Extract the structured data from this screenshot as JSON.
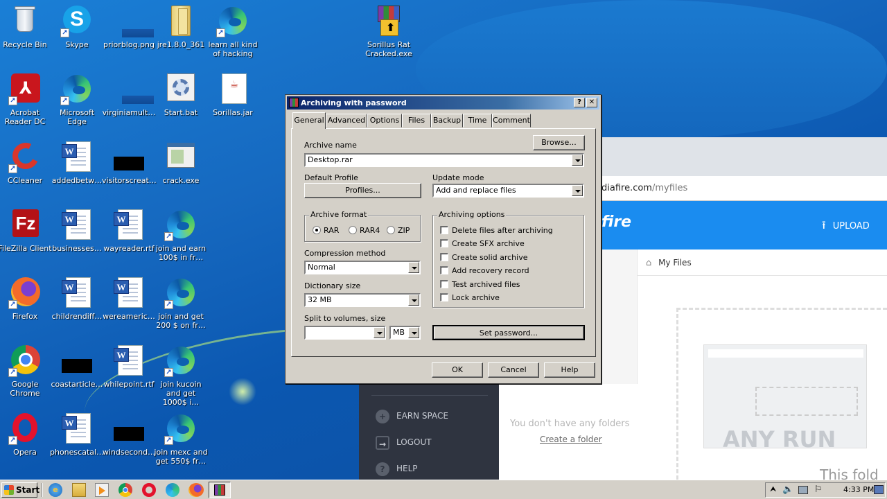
{
  "desktop": {
    "icons": [
      {
        "label": "Recycle Bin",
        "icon": "recycle-bin-icon"
      },
      {
        "label": "Skype",
        "icon": "skype-icon"
      },
      {
        "label": "priorblog.png",
        "icon": "image-file-icon"
      },
      {
        "label": "jre1.8.0_361",
        "icon": "folder-icon"
      },
      {
        "label": "learn all kind of hacking",
        "icon": "edge-shortcut-icon"
      },
      {
        "label": "Sorillus Rat Cracked.exe",
        "icon": "winrar-exe-icon"
      },
      {
        "label": "Acrobat Reader DC",
        "icon": "acrobat-icon"
      },
      {
        "label": "Microsoft Edge",
        "icon": "edge-icon"
      },
      {
        "label": "virginiamult…",
        "icon": "image-file-icon"
      },
      {
        "label": "Start.bat",
        "icon": "batch-file-icon"
      },
      {
        "label": "Sorillas.jar",
        "icon": "java-file-icon"
      },
      {
        "label": "CCleaner",
        "icon": "ccleaner-icon"
      },
      {
        "label": "addedbetw…",
        "icon": "word-doc-icon"
      },
      {
        "label": "visitorscreat…",
        "icon": "image-file-icon"
      },
      {
        "label": "crack.exe",
        "icon": "exe-file-icon"
      },
      {
        "label": "FileZilla Client",
        "icon": "filezilla-icon"
      },
      {
        "label": "businesses…",
        "icon": "word-doc-icon"
      },
      {
        "label": "wayreader.rtf",
        "icon": "word-doc-icon"
      },
      {
        "label": "join and earn 100$ in fr…",
        "icon": "edge-shortcut-icon"
      },
      {
        "label": "Firefox",
        "icon": "firefox-icon"
      },
      {
        "label": "childrendiff…",
        "icon": "word-doc-icon"
      },
      {
        "label": "wereameric…",
        "icon": "word-doc-icon"
      },
      {
        "label": "join and get 200 $ on fr…",
        "icon": "edge-shortcut-icon"
      },
      {
        "label": "Google Chrome",
        "icon": "chrome-icon"
      },
      {
        "label": "coastarticle…",
        "icon": "image-file-icon"
      },
      {
        "label": "whilepoint.rtf",
        "icon": "word-doc-icon"
      },
      {
        "label": "join kucoin and get 1000$ i…",
        "icon": "edge-shortcut-icon"
      },
      {
        "label": "Opera",
        "icon": "opera-icon"
      },
      {
        "label": "phonescatal…",
        "icon": "word-doc-icon"
      },
      {
        "label": "windsecond…",
        "icon": "image-file-icon"
      },
      {
        "label": "join mexc and get 550$ fr…",
        "icon": "edge-shortcut-icon"
      }
    ]
  },
  "browser": {
    "address": "diafire.com",
    "address_path": "/myfiles",
    "brand": "fire",
    "upload_label": "UPLOAD",
    "breadcrumb": "My Files",
    "menu": [
      "EARN SPACE",
      "LOGOUT",
      "HELP"
    ],
    "empty_text": "You don't have any folders",
    "create_folder": "Create a folder",
    "watermark": "ANY RUN",
    "this_fold": "This fold"
  },
  "dialog": {
    "title": "Archiving with password",
    "help_btn": "?",
    "close_btn": "✕",
    "tabs": [
      "General",
      "Advanced",
      "Options",
      "Files",
      "Backup",
      "Time",
      "Comment"
    ],
    "archive_name_label": "Archive name",
    "browse_label": "Browse...",
    "archive_name_value": "Desktop.rar",
    "default_profile_label": "Default Profile",
    "profiles_label": "Profiles...",
    "update_mode_label": "Update mode",
    "update_mode_value": "Add and replace files",
    "archive_format_label": "Archive format",
    "formats": [
      "RAR",
      "RAR4",
      "ZIP"
    ],
    "selected_format": "RAR",
    "archiving_options_label": "Archiving options",
    "options": [
      "Delete files after archiving",
      "Create SFX archive",
      "Create solid archive",
      "Add recovery record",
      "Test archived files",
      "Lock archive"
    ],
    "compression_method_label": "Compression method",
    "compression_method_value": "Normal",
    "dictionary_size_label": "Dictionary size",
    "dictionary_size_value": "32 MB",
    "split_label": "Split to volumes, size",
    "split_value": "",
    "split_unit": "MB",
    "set_password_label": "Set password...",
    "ok_label": "OK",
    "cancel_label": "Cancel",
    "help_label": "Help"
  },
  "taskbar": {
    "start_label": "Start",
    "apps": [
      "ie-icon",
      "explorer-icon",
      "media-player-icon",
      "chrome-icon",
      "opera-icon",
      "edge-icon",
      "firefox-icon",
      "winrar-icon"
    ],
    "clock": "4:33 PM"
  },
  "colors": {
    "desktop_blue": "#1669c0",
    "titlebar_start": "#0a246a",
    "mediafire_blue": "#1a8cf0",
    "mediafire_menu": "#2f3440",
    "win_gray": "#d4d0c8"
  }
}
